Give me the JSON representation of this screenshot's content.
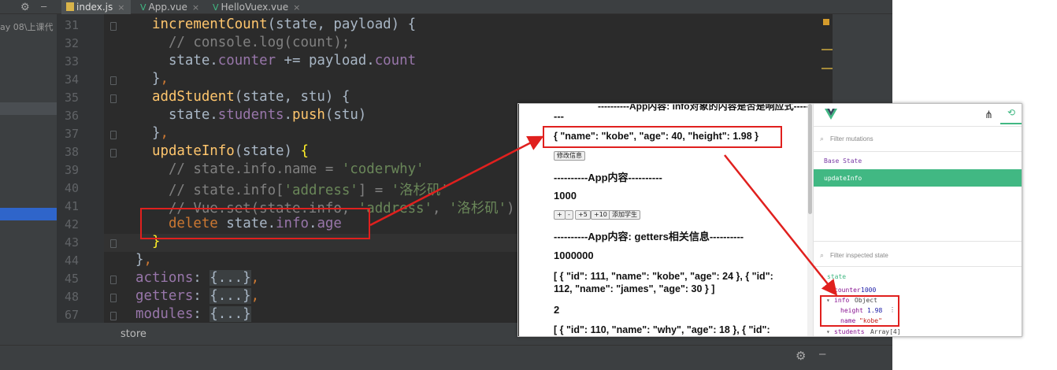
{
  "ide": {
    "tabs": [
      {
        "label": "index.js",
        "icon": "js-file-icon"
      },
      {
        "label": "App.vue",
        "icon": "vue-file-icon"
      },
      {
        "label": "HelloVuex.vue",
        "icon": "vue-file-icon"
      }
    ],
    "project_path": "ay 08\\上课代",
    "breadcrumb": "store",
    "title_overlay": "",
    "lines": [
      {
        "n": "31",
        "code": "incrementCount(state, payload) {"
      },
      {
        "n": "32",
        "code": "  // console.log(count);"
      },
      {
        "n": "33",
        "code": "  state.counter += payload.count"
      },
      {
        "n": "34",
        "code": "},"
      },
      {
        "n": "35",
        "code": "addStudent(state, stu) {"
      },
      {
        "n": "36",
        "code": "  state.students.push(stu)"
      },
      {
        "n": "37",
        "code": "},"
      },
      {
        "n": "38",
        "code": "updateInfo(state) {"
      },
      {
        "n": "39",
        "code": "  // state.info.name = 'coderwhy'"
      },
      {
        "n": "40",
        "code": "  // state.info['address'] = '洛杉矶'"
      },
      {
        "n": "41",
        "code": "  // Vue.set(state.info, 'address', '洛杉矶')"
      },
      {
        "n": "42",
        "code": "  delete state.info.age"
      },
      {
        "n": "43",
        "code": "}"
      },
      {
        "n": "44",
        "code": "},"
      },
      {
        "n": "45",
        "code": "actions: {...},"
      },
      {
        "n": "48",
        "code": "getters: {...},"
      },
      {
        "n": "67",
        "code": "modules: {...}"
      }
    ]
  },
  "app": {
    "heading_top": "----------App内容: info对象的内容是否是响应式----------",
    "heading_top_suffix": "---",
    "info_json": "{ \"name\": \"kobe\", \"age\": 40, \"height\": 1.98 }",
    "modify_button": "修改信息",
    "heading_app": "----------App内容----------",
    "counter": "1000",
    "buttons": [
      "+",
      "-",
      "+5",
      "+10",
      "添加学生"
    ],
    "heading_getters": "----------App内容: getters相关信息----------",
    "power_counter": "1000000",
    "students_line1": "[ { \"id\": 111, \"name\": \"kobe\", \"age\": 24 }, { \"id\":",
    "students_line2": "112, \"name\": \"james\", \"age\": 30 } ]",
    "count": "2",
    "students2_line1": "[ { \"id\": 110, \"name\": \"why\", \"age\": 18 }, { \"id\":"
  },
  "devtools": {
    "filter_mutations": "Filter mutations",
    "base_state": "Base State",
    "selected_mutation": "updateInfo",
    "filter_state": "Filter inspected state",
    "state_label": "state",
    "counter_key": "counter",
    "counter_value": "1000",
    "info_key": "info",
    "info_type": "Object",
    "height_key": "height",
    "height_value": "1.98",
    "name_key": "name",
    "name_value": "\"kobe\"",
    "students_key": "students",
    "students_type": "Array[4]",
    "accent": "#41b883"
  }
}
